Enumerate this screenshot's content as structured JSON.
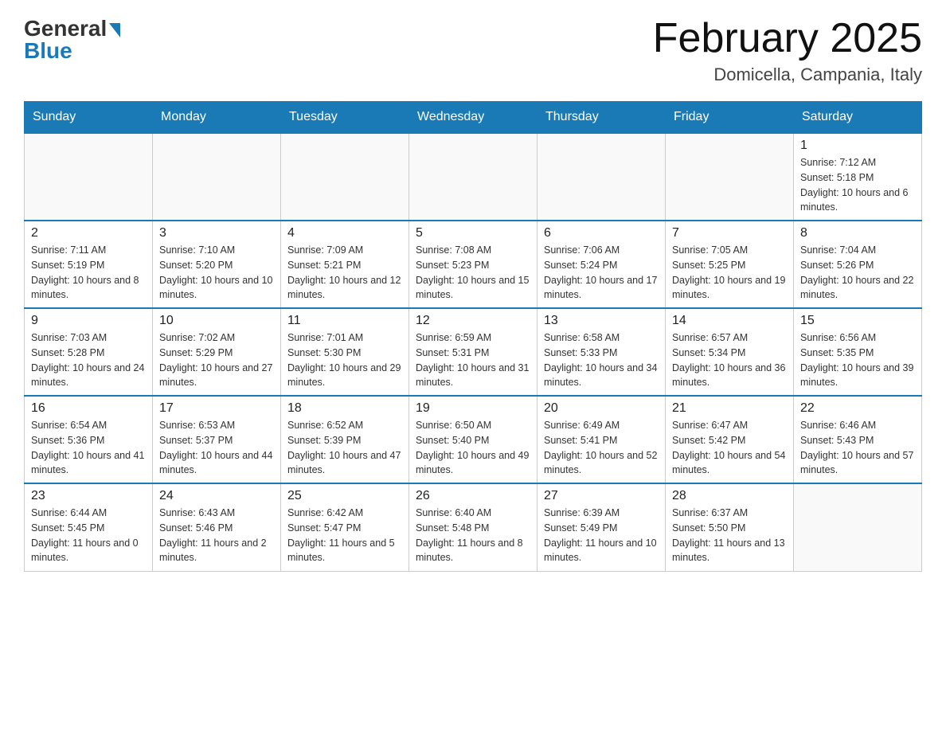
{
  "header": {
    "logo_general": "General",
    "logo_blue": "Blue",
    "month_title": "February 2025",
    "location": "Domicella, Campania, Italy"
  },
  "weekdays": [
    "Sunday",
    "Monday",
    "Tuesday",
    "Wednesday",
    "Thursday",
    "Friday",
    "Saturday"
  ],
  "weeks": [
    [
      {
        "day": "",
        "info": ""
      },
      {
        "day": "",
        "info": ""
      },
      {
        "day": "",
        "info": ""
      },
      {
        "day": "",
        "info": ""
      },
      {
        "day": "",
        "info": ""
      },
      {
        "day": "",
        "info": ""
      },
      {
        "day": "1",
        "info": "Sunrise: 7:12 AM\nSunset: 5:18 PM\nDaylight: 10 hours and 6 minutes."
      }
    ],
    [
      {
        "day": "2",
        "info": "Sunrise: 7:11 AM\nSunset: 5:19 PM\nDaylight: 10 hours and 8 minutes."
      },
      {
        "day": "3",
        "info": "Sunrise: 7:10 AM\nSunset: 5:20 PM\nDaylight: 10 hours and 10 minutes."
      },
      {
        "day": "4",
        "info": "Sunrise: 7:09 AM\nSunset: 5:21 PM\nDaylight: 10 hours and 12 minutes."
      },
      {
        "day": "5",
        "info": "Sunrise: 7:08 AM\nSunset: 5:23 PM\nDaylight: 10 hours and 15 minutes."
      },
      {
        "day": "6",
        "info": "Sunrise: 7:06 AM\nSunset: 5:24 PM\nDaylight: 10 hours and 17 minutes."
      },
      {
        "day": "7",
        "info": "Sunrise: 7:05 AM\nSunset: 5:25 PM\nDaylight: 10 hours and 19 minutes."
      },
      {
        "day": "8",
        "info": "Sunrise: 7:04 AM\nSunset: 5:26 PM\nDaylight: 10 hours and 22 minutes."
      }
    ],
    [
      {
        "day": "9",
        "info": "Sunrise: 7:03 AM\nSunset: 5:28 PM\nDaylight: 10 hours and 24 minutes."
      },
      {
        "day": "10",
        "info": "Sunrise: 7:02 AM\nSunset: 5:29 PM\nDaylight: 10 hours and 27 minutes."
      },
      {
        "day": "11",
        "info": "Sunrise: 7:01 AM\nSunset: 5:30 PM\nDaylight: 10 hours and 29 minutes."
      },
      {
        "day": "12",
        "info": "Sunrise: 6:59 AM\nSunset: 5:31 PM\nDaylight: 10 hours and 31 minutes."
      },
      {
        "day": "13",
        "info": "Sunrise: 6:58 AM\nSunset: 5:33 PM\nDaylight: 10 hours and 34 minutes."
      },
      {
        "day": "14",
        "info": "Sunrise: 6:57 AM\nSunset: 5:34 PM\nDaylight: 10 hours and 36 minutes."
      },
      {
        "day": "15",
        "info": "Sunrise: 6:56 AM\nSunset: 5:35 PM\nDaylight: 10 hours and 39 minutes."
      }
    ],
    [
      {
        "day": "16",
        "info": "Sunrise: 6:54 AM\nSunset: 5:36 PM\nDaylight: 10 hours and 41 minutes."
      },
      {
        "day": "17",
        "info": "Sunrise: 6:53 AM\nSunset: 5:37 PM\nDaylight: 10 hours and 44 minutes."
      },
      {
        "day": "18",
        "info": "Sunrise: 6:52 AM\nSunset: 5:39 PM\nDaylight: 10 hours and 47 minutes."
      },
      {
        "day": "19",
        "info": "Sunrise: 6:50 AM\nSunset: 5:40 PM\nDaylight: 10 hours and 49 minutes."
      },
      {
        "day": "20",
        "info": "Sunrise: 6:49 AM\nSunset: 5:41 PM\nDaylight: 10 hours and 52 minutes."
      },
      {
        "day": "21",
        "info": "Sunrise: 6:47 AM\nSunset: 5:42 PM\nDaylight: 10 hours and 54 minutes."
      },
      {
        "day": "22",
        "info": "Sunrise: 6:46 AM\nSunset: 5:43 PM\nDaylight: 10 hours and 57 minutes."
      }
    ],
    [
      {
        "day": "23",
        "info": "Sunrise: 6:44 AM\nSunset: 5:45 PM\nDaylight: 11 hours and 0 minutes."
      },
      {
        "day": "24",
        "info": "Sunrise: 6:43 AM\nSunset: 5:46 PM\nDaylight: 11 hours and 2 minutes."
      },
      {
        "day": "25",
        "info": "Sunrise: 6:42 AM\nSunset: 5:47 PM\nDaylight: 11 hours and 5 minutes."
      },
      {
        "day": "26",
        "info": "Sunrise: 6:40 AM\nSunset: 5:48 PM\nDaylight: 11 hours and 8 minutes."
      },
      {
        "day": "27",
        "info": "Sunrise: 6:39 AM\nSunset: 5:49 PM\nDaylight: 11 hours and 10 minutes."
      },
      {
        "day": "28",
        "info": "Sunrise: 6:37 AM\nSunset: 5:50 PM\nDaylight: 11 hours and 13 minutes."
      },
      {
        "day": "",
        "info": ""
      }
    ]
  ]
}
